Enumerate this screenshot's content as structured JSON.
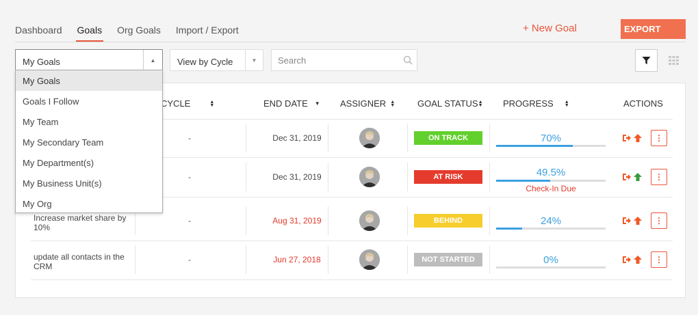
{
  "tabs": [
    {
      "label": "Dashboard",
      "active": false
    },
    {
      "label": "Goals",
      "active": true
    },
    {
      "label": "Org Goals",
      "active": false
    },
    {
      "label": "Import / Export",
      "active": false
    }
  ],
  "header": {
    "new_goal": "+ New Goal",
    "export": "EXPORT"
  },
  "filters": {
    "scope_selected": "My Goals",
    "view_selected": "View by Cycle",
    "search_placeholder": "Search"
  },
  "dropdown": {
    "options": [
      "My Goals",
      "Goals I Follow",
      "My Team",
      "My Secondary Team",
      "My Department(s)",
      "My Business Unit(s)",
      "My Org"
    ],
    "selected": "My Goals"
  },
  "columns": {
    "cycle": "CYCLE",
    "end_date": "END DATE",
    "assigner": "ASSIGNER",
    "goal_status": "GOAL STATUS",
    "progress": "PROGRESS",
    "actions": "ACTIONS"
  },
  "rows": [
    {
      "name": "",
      "cycle": "-",
      "end_date": "Dec 31, 2019",
      "overdue": false,
      "status": "ON TRACK",
      "status_color": "#62d02c",
      "progress_text": "70%",
      "progress": 0.7,
      "checkin": "",
      "arrow_color": "#f05a28"
    },
    {
      "name": "",
      "cycle": "-",
      "end_date": "Dec 31, 2019",
      "overdue": false,
      "status": "AT RISK",
      "status_color": "#e53b2c",
      "progress_text": "49.5%",
      "progress": 0.495,
      "checkin": "Check-In Due",
      "arrow_color": "#3c9a3c"
    },
    {
      "name": "Increase market share by 10%",
      "cycle": "-",
      "end_date": "Aug 31, 2019",
      "overdue": true,
      "status": "BEHIND",
      "status_color": "#f6cd2c",
      "progress_text": "24%",
      "progress": 0.24,
      "checkin": "",
      "arrow_color": "#f05a28"
    },
    {
      "name": "update all contacts in the CRM",
      "cycle": "-",
      "end_date": "Jun 27, 2018",
      "overdue": true,
      "status": "NOT STARTED",
      "status_color": "#bdbdbd",
      "progress_text": "0%",
      "progress": 0,
      "checkin": "",
      "arrow_color": "#f05a28"
    }
  ],
  "colors": {
    "accent": "#e8553a",
    "progress": "#3aa0e0"
  },
  "icons": {
    "search": "search-icon",
    "filter": "filter-icon",
    "grid": "grid-icon",
    "actions": [
      "sign-out-icon",
      "arrow-up-icon",
      "more-icon"
    ]
  }
}
